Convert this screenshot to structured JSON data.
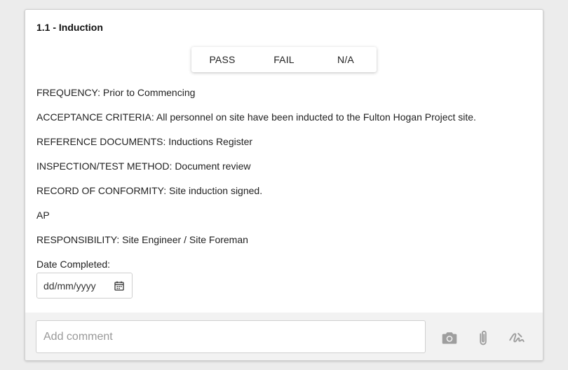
{
  "item": {
    "title": "1.1 - Induction"
  },
  "result_options": [
    "PASS",
    "FAIL",
    "N/A"
  ],
  "fields": {
    "frequency": "FREQUENCY: Prior to Commencing",
    "acceptance": "ACCEPTANCE CRITERIA: All personnel on site have been inducted to the Fulton Hogan Project site.",
    "reference": "REFERENCE DOCUMENTS: Inductions Register",
    "method": "INSPECTION/TEST METHOD: Document review",
    "record": "RECORD OF CONFORMITY: Site induction signed.",
    "ap": "AP",
    "responsibility": "RESPONSIBILITY: Site Engineer / Site Foreman"
  },
  "date": {
    "label": "Date Completed:",
    "placeholder": "dd/mm/yyyy",
    "icon": "calendar-icon"
  },
  "comment": {
    "placeholder": "Add comment"
  },
  "footer_icons": [
    "camera-icon",
    "paperclip-icon",
    "signature-icon"
  ],
  "colors": {
    "icon_gray": "#9e9e9e",
    "footer_bg": "#f2f2f2"
  }
}
